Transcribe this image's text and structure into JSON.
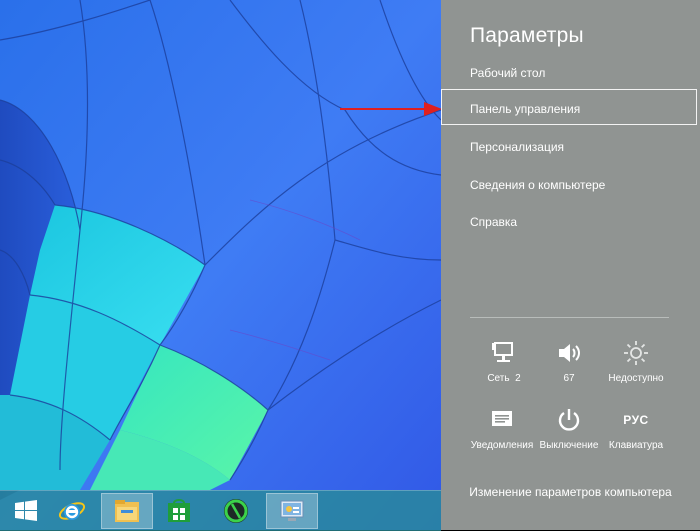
{
  "charm": {
    "title": "Параметры",
    "items": [
      {
        "label": "Рабочий стол"
      },
      {
        "label": "Панель управления"
      },
      {
        "label": "Персонализация"
      },
      {
        "label": "Сведения о компьютере"
      },
      {
        "label": "Справка"
      }
    ],
    "highlighted_item": "Панель управления",
    "tiles": [
      {
        "icon": "network-icon",
        "label": "Сеть",
        "value": "2"
      },
      {
        "icon": "volume-icon",
        "label": "67"
      },
      {
        "icon": "brightness-icon",
        "label": "Недоступно"
      },
      {
        "icon": "notifications-icon",
        "label": "Уведомления"
      },
      {
        "icon": "power-icon",
        "label": "Выключение"
      },
      {
        "icon": "keyboard-icon",
        "glyph": "РУС",
        "label": "Клавиатура"
      }
    ],
    "change_settings_label": "Изменение параметров компьютера"
  },
  "taskbar": {
    "items": [
      {
        "icon": "windows-start-icon"
      },
      {
        "icon": "internet-explorer-icon"
      },
      {
        "icon": "file-explorer-icon",
        "active": true
      },
      {
        "icon": "store-icon"
      },
      {
        "icon": "green-circle-app-icon"
      },
      {
        "icon": "control-panel-icon",
        "active": true
      }
    ]
  },
  "colors": {
    "charm_background": "#909492",
    "arrow": "#e02020",
    "wallpaper_blue": "#2f66ea",
    "wallpaper_cyan": "#24d6e6",
    "wallpaper_green": "#3cf0b4"
  }
}
